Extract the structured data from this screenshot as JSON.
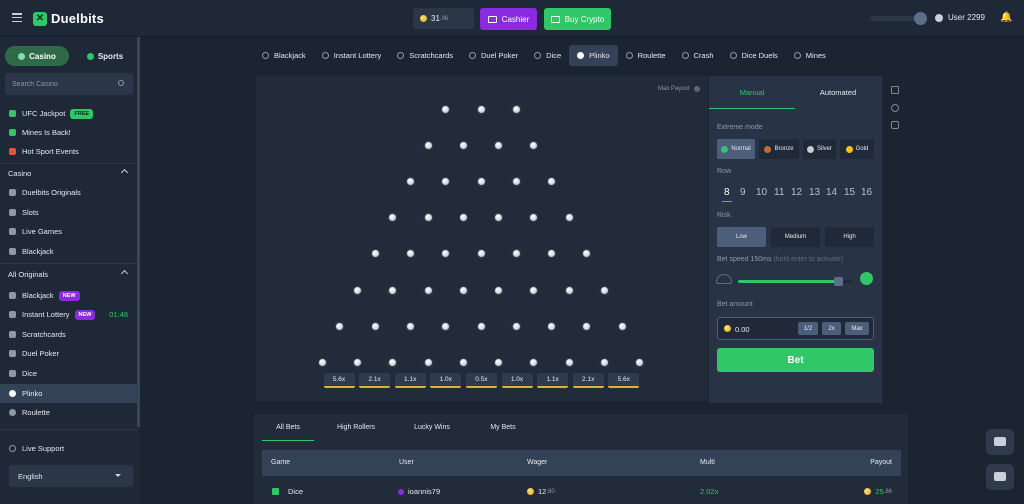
{
  "header": {
    "brand": "Duelbits",
    "balance_main": "31",
    "balance_cents": ".96",
    "cashier_label": "Cashier",
    "buy_crypto_label": "Buy Crypto",
    "username": "User 2299"
  },
  "sidebar": {
    "casino_label": "Casino",
    "sports_label": "Sports",
    "search_placeholder": "Search Casino",
    "promo_items": [
      {
        "label": "UFC Jackpot",
        "badge": "FREE"
      },
      {
        "label": "Mines Is Back!"
      },
      {
        "label": "Hot Sport Events"
      }
    ],
    "casino_section": "Casino",
    "casino_items": [
      "Duelbits Originals",
      "Slots",
      "Live Games",
      "Blackjack"
    ],
    "originals_section": "All Originals",
    "original_items": [
      {
        "label": "Blackjack",
        "badge": "NEW"
      },
      {
        "label": "Instant Lottery",
        "badge": "NEW",
        "timer": "01:48"
      },
      {
        "label": "Scratchcards"
      },
      {
        "label": "Duel Poker"
      },
      {
        "label": "Dice"
      },
      {
        "label": "Plinko"
      },
      {
        "label": "Roulette"
      }
    ],
    "live_support": "Live Support",
    "language": "English"
  },
  "game_tabs": [
    "Blackjack",
    "Instant Lottery",
    "Scratchcards",
    "Duel Poker",
    "Dice",
    "Plinko",
    "Roulette",
    "Crash",
    "Dice Duels",
    "Mines"
  ],
  "active_game": "Plinko",
  "board": {
    "max_payout_label": "Max Payout",
    "multipliers": [
      "5.6x",
      "2.1x",
      "1.1x",
      "1.0x",
      "0.5x",
      "1.0x",
      "1.1x",
      "2.1x",
      "5.6x"
    ]
  },
  "panel": {
    "manual_tab": "Manual",
    "automated_tab": "Automated",
    "extreme_mode_label": "Extreme mode",
    "extreme_modes": [
      "Normal",
      "Bronze",
      "Silver",
      "Gold"
    ],
    "row_label": "Row",
    "rows": [
      "8",
      "9",
      "10",
      "11",
      "12",
      "13",
      "14",
      "15",
      "16"
    ],
    "selected_row": "8",
    "risk_label": "Risk",
    "risks": [
      "Low",
      "Medium",
      "High"
    ],
    "bet_speed_label": "Bet speed 150ms",
    "bet_speed_hint": "(hold enter to activate)",
    "bet_speed_fraction": 0.88,
    "bet_amount_label": "Bet amount",
    "bet_amount_value": "0.00",
    "half_label": "1/2",
    "double_label": "2x",
    "max_label": "Max",
    "bet_label": "Bet"
  },
  "bets": {
    "tabs": [
      "All Bets",
      "High Rollers",
      "Lucky Wins",
      "My Bets"
    ],
    "columns": [
      "Game",
      "User",
      "Wager",
      "Multi",
      "Payout"
    ],
    "rows": [
      {
        "game": "Dice",
        "user": "ioannis79",
        "wager_main": "12",
        "wager_cents": ".80",
        "multi": "2.02x",
        "payout_main": "25",
        "payout_cents": ".86"
      }
    ]
  },
  "colors": {
    "accent": "#2fc767",
    "purple": "#8a2be2",
    "panel": "#283445",
    "bg": "#1b2431"
  }
}
